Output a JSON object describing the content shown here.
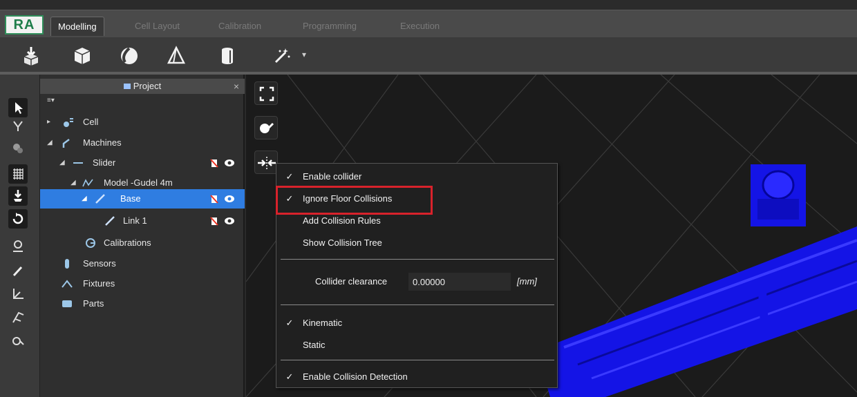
{
  "logo": {
    "text": "RA"
  },
  "tabs": [
    {
      "label": "Modelling",
      "active": true
    },
    {
      "label": "Cell Layout",
      "active": false
    },
    {
      "label": "Calibration",
      "active": false
    },
    {
      "label": "Programming",
      "active": false
    },
    {
      "label": "Execution",
      "active": false
    }
  ],
  "toolbar": {
    "icons": [
      "import-icon",
      "cube-icon",
      "sphere-icon",
      "cone-icon",
      "cylinder-icon",
      "magic-wand-icon"
    ],
    "wand_dropdown": "▾"
  },
  "project_panel": {
    "title": "Project",
    "close": "×",
    "menu_icon": "≡▾",
    "tree": [
      {
        "label": "Cell",
        "expand": "▸",
        "icon": "cell-icon"
      },
      {
        "label": "Machines",
        "expand": "◢",
        "icon": "machines-icon"
      },
      {
        "label": "Slider",
        "expand": "◢",
        "icon": "slider-icon"
      },
      {
        "label": "Model -Gudel 4m",
        "expand": "◢",
        "icon": "model-icon"
      },
      {
        "label": "Base",
        "expand": "◢",
        "icon": "link-icon",
        "selected": true
      },
      {
        "label": "Link 1",
        "expand": "",
        "icon": "link-icon"
      },
      {
        "label": "Calibrations",
        "expand": "",
        "icon": "calibration-icon"
      },
      {
        "label": "Sensors",
        "expand": "",
        "icon": "sensor-icon"
      },
      {
        "label": "Fixtures",
        "expand": "",
        "icon": "fixture-icon"
      },
      {
        "label": "Parts",
        "expand": "",
        "icon": "part-icon"
      }
    ]
  },
  "context_menu": {
    "check": "✓",
    "enable_collider": "Enable collider",
    "ignore_floor": "Ignore Floor Collisions",
    "add_rules": "Add Collision Rules",
    "show_tree": "Show Collision Tree",
    "clearance_label": "Collider clearance",
    "clearance_value": "0.00000",
    "clearance_unit": "[mm]",
    "kinematic": "Kinematic",
    "static": "Static",
    "enable_detection": "Enable Collision Detection"
  },
  "colors": {
    "selection": "#2f7de1",
    "highlight_box": "#d8222b",
    "model_blue": "#1414e6"
  }
}
